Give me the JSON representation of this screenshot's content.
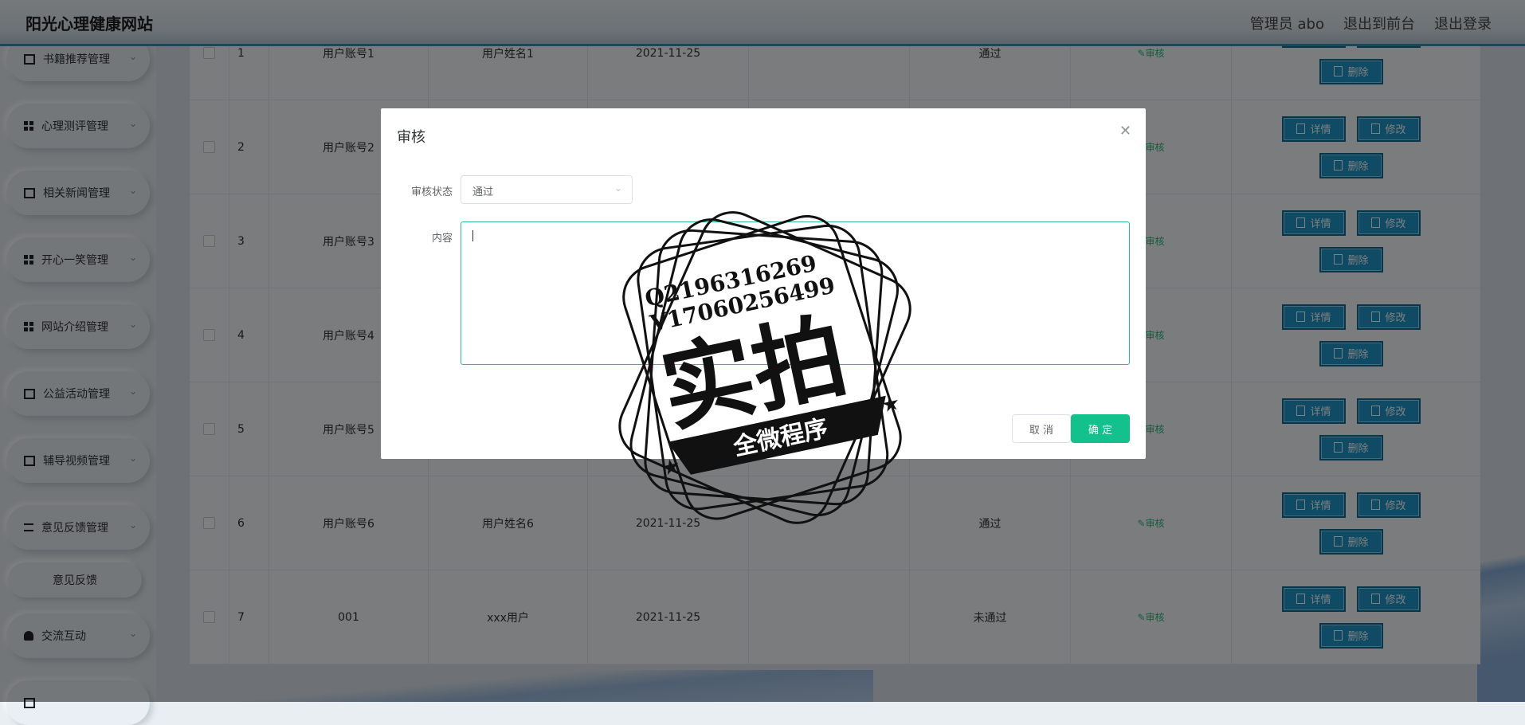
{
  "header": {
    "logo": "阳光心理健康网站",
    "user_label": "管理员 abo",
    "frontend_link": "退出到前台",
    "logout_link": "退出登录"
  },
  "sidebar": {
    "items": [
      {
        "label": "书籍推荐管理",
        "icon": "book-icon"
      },
      {
        "label": "心理测评管理",
        "icon": "grid-icon"
      },
      {
        "label": "相关新闻管理",
        "icon": "chart-icon"
      },
      {
        "label": "开心一笑管理",
        "icon": "grid-icon"
      },
      {
        "label": "网站介绍管理",
        "icon": "grid-icon"
      },
      {
        "label": "公益活动管理",
        "icon": "flag-icon"
      },
      {
        "label": "辅导视频管理",
        "icon": "video-icon"
      },
      {
        "label": "意见反馈管理",
        "icon": "sliders-icon"
      },
      {
        "label": "交流互动",
        "icon": "user-icon"
      }
    ],
    "sub_item": "意见反馈"
  },
  "table": {
    "rows": [
      {
        "index": "1",
        "account": "用户账号1",
        "name": "用户姓名1",
        "date": "2021-11-25",
        "status": "通过"
      },
      {
        "index": "2",
        "account": "用户账号2",
        "name": "",
        "date": "",
        "status": ""
      },
      {
        "index": "3",
        "account": "用户账号3",
        "name": "",
        "date": "",
        "status": ""
      },
      {
        "index": "4",
        "account": "用户账号4",
        "name": "",
        "date": "",
        "status": ""
      },
      {
        "index": "5",
        "account": "用户账号5",
        "name": "",
        "date": "",
        "status": ""
      },
      {
        "index": "6",
        "account": "用户账号6",
        "name": "用户姓名6",
        "date": "2021-11-25",
        "status": "通过"
      },
      {
        "index": "7",
        "account": "001",
        "name": "xxx用户",
        "date": "2021-11-25",
        "status": "未通过"
      }
    ],
    "audit_link": "审核",
    "detail_btn": "详情",
    "edit_btn": "修改",
    "delete_btn": "删除"
  },
  "dialog": {
    "title": "审核",
    "status_label": "审核状态",
    "status_value": "通过",
    "content_label": "内容",
    "content_value": "",
    "cancel_btn": "取 消",
    "ok_btn": "确 定"
  },
  "watermark": {
    "line1": "Q2196316269",
    "line2": "V17060256499",
    "main": "实拍",
    "banner": "全微程序"
  },
  "colors": {
    "accent": "#13c18c",
    "op_button": "#1f96c8",
    "header_border": "#3a8fb7"
  }
}
